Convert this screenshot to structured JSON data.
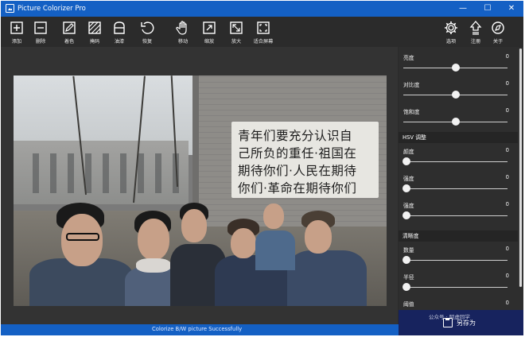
{
  "window": {
    "title": "Picture Colorizer Pro",
    "minimize_glyph": "—",
    "maximize_glyph": "☐",
    "close_glyph": "✕"
  },
  "toolbar": {
    "items": [
      {
        "label": "添加",
        "icon": "add-box-icon"
      },
      {
        "label": "删除",
        "icon": "remove-box-icon"
      },
      {
        "label": "着色",
        "icon": "brush-edit-icon"
      },
      {
        "label": "掩码",
        "icon": "hatch-mask-icon"
      },
      {
        "label": "油漆",
        "icon": "bucket-icon"
      },
      {
        "label": "恢复",
        "icon": "undo-icon"
      },
      {
        "label": "移动",
        "icon": "hand-icon"
      },
      {
        "label": "缩放",
        "icon": "zoom-box-icon"
      },
      {
        "label": "放大",
        "icon": "expand-icon"
      },
      {
        "label": "适合屏幕",
        "icon": "fit-screen-icon"
      }
    ],
    "right_items": [
      {
        "label": "选项",
        "icon": "gear-icon"
      },
      {
        "label": "注册",
        "icon": "upload-arrow-icon"
      },
      {
        "label": "关于",
        "icon": "compass-icon"
      }
    ]
  },
  "photo": {
    "slogan_lines": [
      "青年们要充分认识自",
      "己所负的重任·祖国在",
      "期待你们·人民在期待",
      "你们·革命在期待你们"
    ]
  },
  "panel": {
    "adjust": [
      {
        "label": "亮度",
        "value": "0",
        "level": 0.5
      },
      {
        "label": "对比度",
        "value": "0",
        "level": 0.5
      },
      {
        "label": "饱和度",
        "value": "0",
        "level": 0.5
      }
    ],
    "hsv_title": "HSV 调整",
    "hsv": [
      {
        "label": "颜度",
        "value": "0",
        "level": 0.0
      },
      {
        "label": "强度",
        "value": "0",
        "level": 0.0
      },
      {
        "label": "强度",
        "value": "0",
        "level": 0.0
      }
    ],
    "sharpen_title": "清晰度",
    "sharpen": [
      {
        "label": "数量",
        "value": "0",
        "level": 0.0
      },
      {
        "label": "半径",
        "value": "0",
        "level": 0.0
      },
      {
        "label": "阈值",
        "value": "0",
        "level": 0.0
      }
    ]
  },
  "save": {
    "label": "另存为",
    "watermark": "公众号 · 阿虚同学"
  },
  "status": {
    "text": "Colorize B/W picture Successfully"
  }
}
